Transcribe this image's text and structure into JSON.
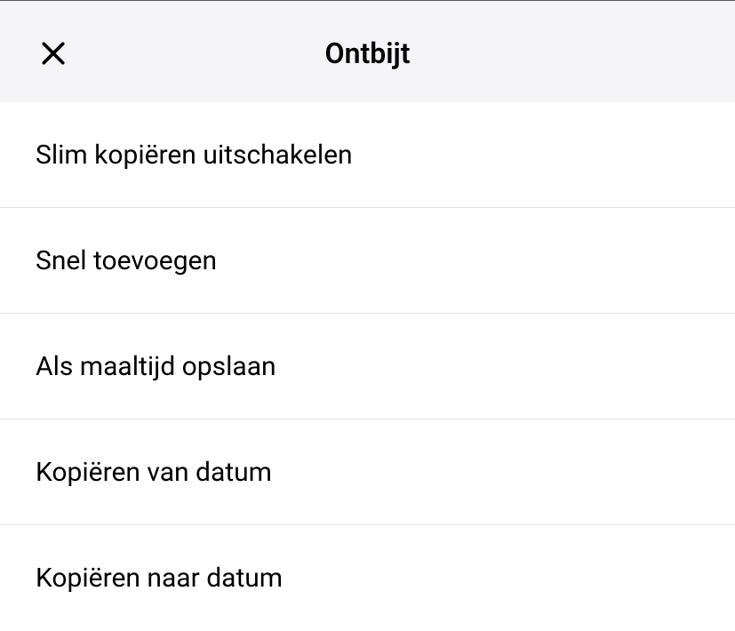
{
  "header": {
    "title": "Ontbijt"
  },
  "menu": {
    "items": [
      {
        "label": "Slim kopiëren uitschakelen"
      },
      {
        "label": "Snel toevoegen"
      },
      {
        "label": "Als maaltijd opslaan"
      },
      {
        "label": "Kopiëren van datum"
      },
      {
        "label": "Kopiëren naar datum"
      }
    ]
  }
}
